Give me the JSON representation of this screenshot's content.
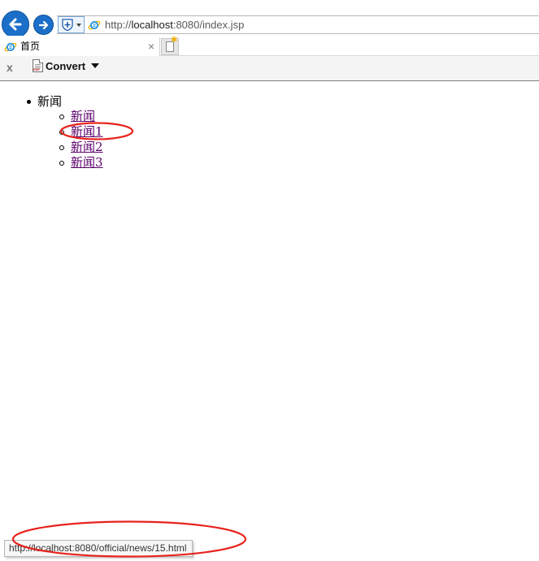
{
  "browser": {
    "address_bar": {
      "url_prefix": "http://",
      "url_host": "localhost",
      "url_rest": ":8080/index.jsp"
    },
    "tabs": [
      {
        "title": "首页",
        "close_glyph": "×"
      }
    ],
    "command_bar": {
      "close_glyph": "x",
      "convert_label": "Convert"
    },
    "status_bar": {
      "hover_url": "http://localhost:8080/official/news/15.html"
    },
    "icons": {
      "back": "back-arrow-icon",
      "forward": "forward-arrow-icon",
      "compat": "compatibility-view-icon",
      "page": "ie-favicon",
      "new_tab": "new-tab-icon",
      "pdf": "pdf-convert-icon"
    },
    "colors": {
      "nav_button": "#1c6fc9",
      "visited_link": "#5b006b",
      "annotation": "#e8221b"
    }
  },
  "page": {
    "nav": {
      "label": "新闻",
      "items": [
        {
          "label": "新闻"
        },
        {
          "label": "新闻1",
          "highlighted": true
        },
        {
          "label": "新闻2"
        },
        {
          "label": "新闻3"
        }
      ]
    }
  }
}
